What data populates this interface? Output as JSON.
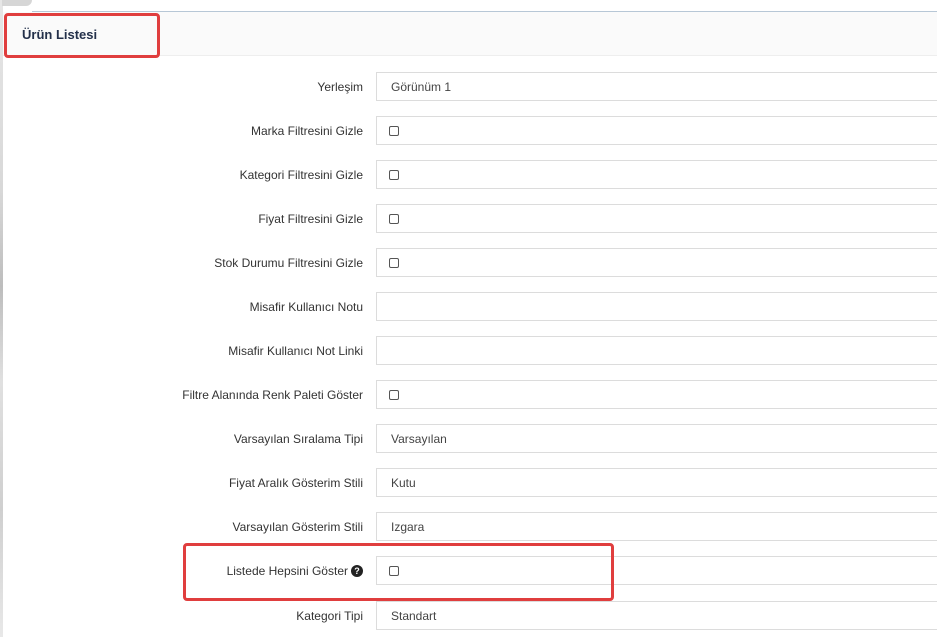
{
  "panel": {
    "title": "Ürün Listesi"
  },
  "help_icon_glyph": "?",
  "rows": [
    {
      "label": "Yerleşim",
      "type": "select",
      "value": "Görünüm 1"
    },
    {
      "label": "Marka Filtresini Gizle",
      "type": "checkbox",
      "checked": false
    },
    {
      "label": "Kategori Filtresini Gizle",
      "type": "checkbox",
      "checked": false
    },
    {
      "label": "Fiyat Filtresini Gizle",
      "type": "checkbox",
      "checked": false
    },
    {
      "label": "Stok Durumu Filtresini Gizle",
      "type": "checkbox",
      "checked": false
    },
    {
      "label": "Misafir Kullanıcı Notu",
      "type": "text",
      "value": ""
    },
    {
      "label": "Misafir Kullanıcı Not Linki",
      "type": "text",
      "value": ""
    },
    {
      "label": "Filtre Alanında Renk Paleti Göster",
      "type": "checkbox",
      "checked": false
    },
    {
      "label": "Varsayılan Sıralama Tipi",
      "type": "select",
      "value": "Varsayılan"
    },
    {
      "label": "Fiyat Aralık Gösterim Stili",
      "type": "select",
      "value": "Kutu"
    },
    {
      "label": "Varsayılan Gösterim Stili",
      "type": "select",
      "value": "Izgara"
    },
    {
      "label": "Listede Hepsini Göster",
      "type": "checkbox",
      "checked": false,
      "help_icon": "question-circle-icon"
    },
    {
      "label": "Kategori Tipi",
      "type": "select",
      "value": "Standart"
    }
  ],
  "colors": {
    "annotation": "#e03e3e",
    "title": "#23304a",
    "field_border": "#dcdcdc"
  }
}
